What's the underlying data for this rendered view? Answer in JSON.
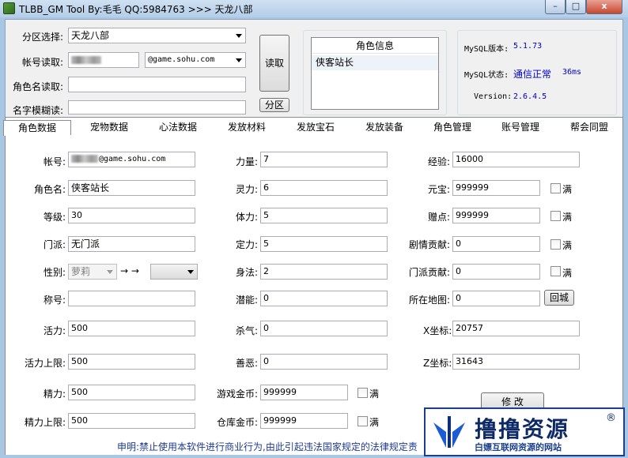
{
  "window": {
    "title": "TLBB_GM Tool By:毛毛 QQ:5984763 >>> 天龙八部",
    "min": "–",
    "max": "□",
    "close": "x"
  },
  "top": {
    "region_label": "分区选择:",
    "region_value": "天龙八部",
    "account_label": "帐号读取:",
    "domain_value": "@game.sohu.com",
    "rolename_label": "角色名读取:",
    "fuzzy_label": "名字模糊读:",
    "read_button": "读取",
    "region_button": "分区"
  },
  "roleinfo": {
    "header": "角色信息",
    "items": [
      "侠客站长"
    ]
  },
  "mysql": {
    "version_label": "MySQL版本:",
    "version_value": "5.1.73",
    "status_label": "MySQL状态:",
    "status_value": "通信正常",
    "latency": "36ms",
    "ver_label": "Version:",
    "ver_value": "2.6.4.5"
  },
  "tabs": [
    "角色数据",
    "宠物数据",
    "心法数据",
    "发放材料",
    "发放宝石",
    "发放装备",
    "角色管理",
    "账号管理",
    "帮会同盟"
  ],
  "form": {
    "account_label": "帐号:",
    "account_suffix": "@game.sohu.com",
    "rolename_label": "角色名:",
    "rolename_value": "侠客站长",
    "level_label": "等级:",
    "level_value": "30",
    "sect_label": "门派:",
    "sect_value": "无门派",
    "gender_label": "性别:",
    "gender_value": "萝莉",
    "arrow": "→ →",
    "nick_label": "称号:",
    "nick_value": "",
    "vigor_label": "活力:",
    "vigor_value": "500",
    "vigormax_label": "活力上限:",
    "vigormax_value": "500",
    "energy_label": "精力:",
    "energy_value": "500",
    "energymax_label": "精力上限:",
    "energymax_value": "500",
    "str_label": "力量:",
    "str_value": "7",
    "spi_label": "灵力:",
    "spi_value": "6",
    "con_label": "体力:",
    "con_value": "5",
    "fix_label": "定力:",
    "fix_value": "5",
    "agi_label": "身法:",
    "agi_value": "2",
    "pot_label": "潜能:",
    "pot_value": "0",
    "kill_label": "杀气:",
    "kill_value": "0",
    "good_label": "善恶:",
    "good_value": "0",
    "gold_label": "游戏金币:",
    "gold_value": "999999",
    "bankgold_label": "仓库金币:",
    "bankgold_value": "999999",
    "exp_label": "经验:",
    "exp_value": "16000",
    "yb_label": "元宝:",
    "yb_value": "999999",
    "zd_label": "赠点:",
    "zd_value": "999999",
    "story_label": "剧情贡献:",
    "story_value": "0",
    "sectc_label": "门派贡献:",
    "sectc_value": "0",
    "map_label": "所在地图:",
    "map_value": "0",
    "return_button": "回城",
    "x_label": "X坐标:",
    "x_value": "20757",
    "z_label": "Z坐标:",
    "z_value": "31643",
    "full": "满",
    "modify_button": "修 改"
  },
  "notice": "申明:禁止使用本软件进行商业行为,由此引起违法国家规定的法律规定责",
  "watermark": {
    "title": "撸撸资源",
    "sub": "白嫖互联网资源的网站",
    "reg": "®"
  }
}
